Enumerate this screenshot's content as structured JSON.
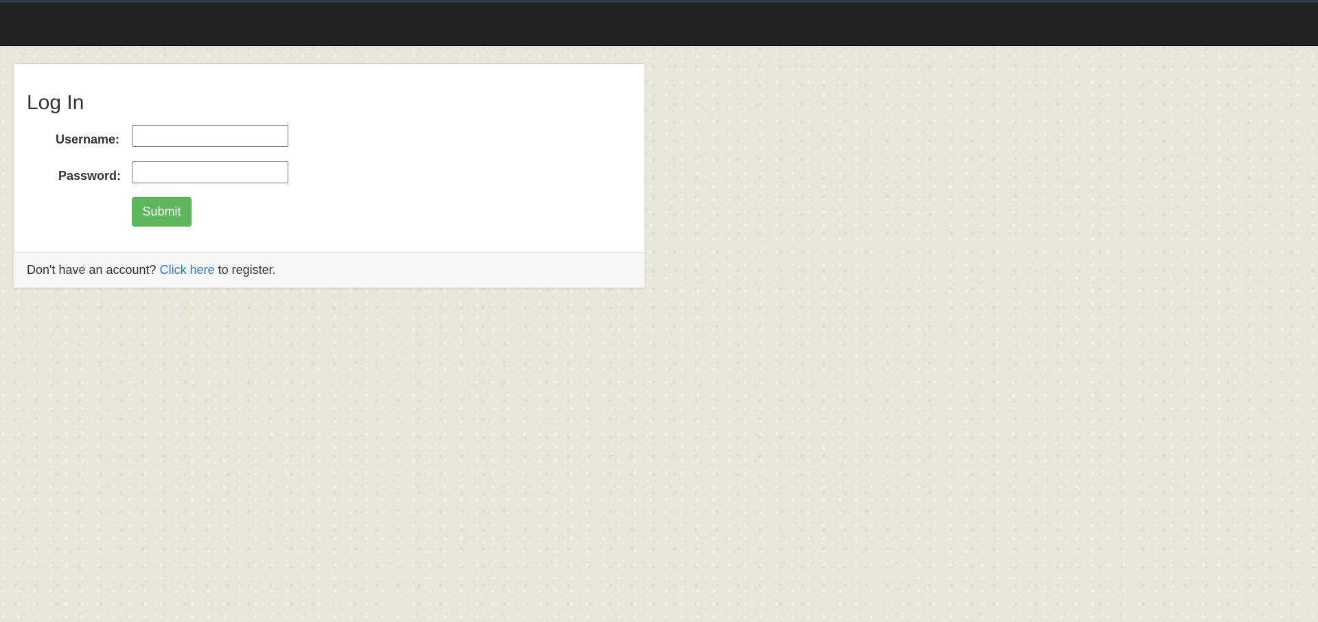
{
  "login": {
    "title": "Log In",
    "username_label": "Username:",
    "username_value": "",
    "password_label": "Password:",
    "password_value": "",
    "submit_label": "Submit"
  },
  "footer": {
    "prefix": "Don't have an account?",
    "link_text": "Click here",
    "suffix": "to register."
  },
  "colors": {
    "navbar": "#222222",
    "submit": "#5cb85c",
    "link": "#337ab7",
    "background": "#e8e5d9"
  }
}
